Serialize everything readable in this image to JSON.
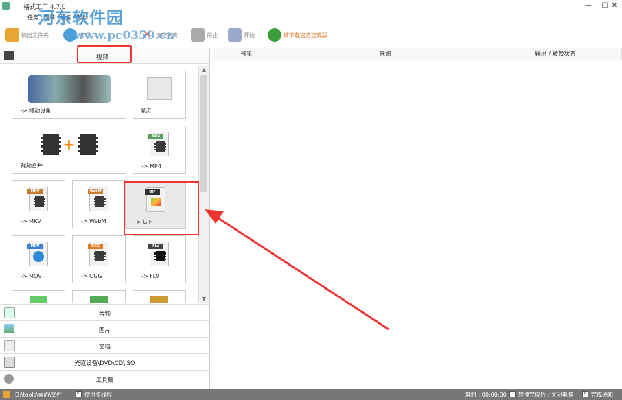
{
  "window": {
    "title": "格式工厂 4.7.0",
    "minimize": "—",
    "maximize": "☐",
    "close": "✕"
  },
  "menu": [
    "任务",
    "皮肤",
    "语言",
    "帮助"
  ],
  "watermark": {
    "name": "河东软件园",
    "url": "www.pc0359.cn"
  },
  "toolbar": {
    "output_folder": "输出文件夹",
    "options": "选项",
    "clear_list": "清空列表",
    "stop": "停止",
    "start": "开始",
    "download": "请下载官方正式版"
  },
  "left_panel": {
    "category_title": "视频",
    "tiles": {
      "mobile": "-> 移动设备",
      "mix": "混流",
      "merge": "视频合并",
      "mp4": "-> MP4",
      "mkv": "-> MKV",
      "webm": "-> WebM",
      "gif": "-> GIF",
      "mov": "-> MOV",
      "ogg": "-> OGG",
      "flv": "-> FLV"
    },
    "tile_badges": {
      "mp4": "MP4",
      "mkv": "MKV",
      "webm": "WebM",
      "gif": "GIF",
      "mov": "MOV",
      "ogg": "OGG",
      "flv": "FLV"
    },
    "categories": {
      "audio": "音频",
      "picture": "图片",
      "document": "文档",
      "rom": "光驱设备\\DVD\\CD\\ISO",
      "tools": "工具集"
    }
  },
  "table": {
    "col_preview": "预览",
    "col_source": "来源",
    "col_status": "输出 / 转换状态"
  },
  "status": {
    "output_path": "D:\\tools\\桌面\\文件",
    "multithread": "使用多线程",
    "elapsed": "耗时 : 00:00:00",
    "after_done": "转换完成后 : 关闭电脑",
    "notify": "完成通知"
  },
  "colors": {
    "highlight": "#ee3333",
    "statusbar": "#777777",
    "watermark": "#3a8fd0"
  }
}
